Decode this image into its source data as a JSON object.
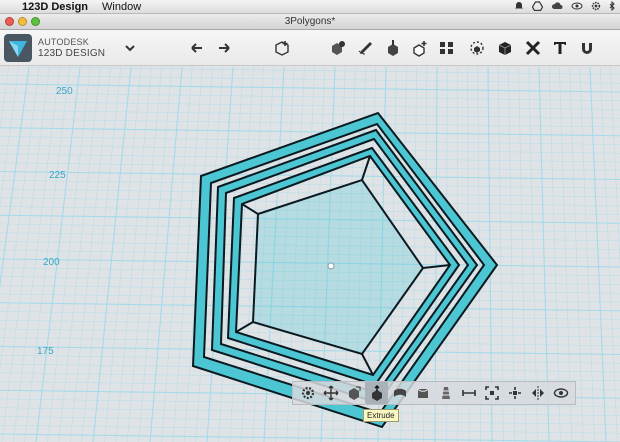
{
  "menubar": {
    "apple": "",
    "app": "123D Design",
    "menu": "Window"
  },
  "window": {
    "title": "3Polygons*"
  },
  "brand": {
    "line1": "AUTODESK",
    "line2": "123D DESIGN"
  },
  "axis": {
    "y_labels": [
      "250",
      "225",
      "200",
      "175"
    ]
  },
  "tooltip": {
    "text": "Extrude"
  },
  "colors": {
    "accent": "#4cc6d3",
    "grid": "#9fd9ea",
    "fill": "#c7eff2"
  }
}
